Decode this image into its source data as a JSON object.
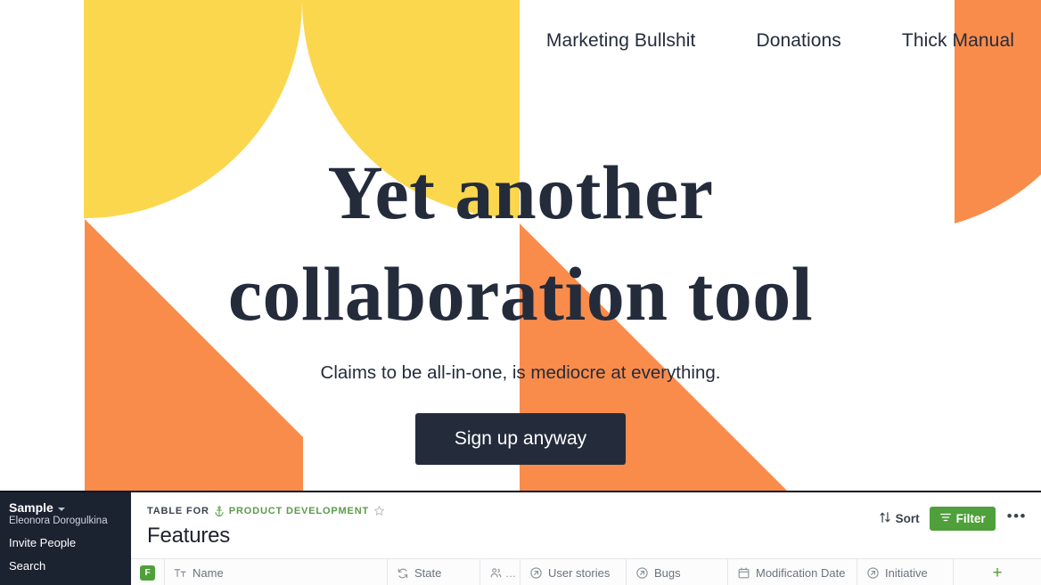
{
  "hero": {
    "nav": [
      {
        "label": "Marketing Bullshit"
      },
      {
        "label": "Donations"
      },
      {
        "label": "Thick Manual"
      }
    ],
    "title": "Yet another collaboration tool",
    "subtitle": "Claims to be all-in-one, is mediocre at everything.",
    "cta_label": "Sign up anyway",
    "colors": {
      "yellow": "#fbd74e",
      "orange": "#fa8c4b",
      "navy": "#242c3c",
      "white": "#ffffff"
    }
  },
  "app": {
    "sidebar": {
      "workspace_name": "Sample",
      "workspace_chevron": "chevron-down-icon",
      "user_name": "Eleonora Dorogulkina",
      "items": [
        {
          "label": "Invite People"
        },
        {
          "label": "Search"
        }
      ]
    },
    "main": {
      "breadcrumb_prefix": "TABLE FOR",
      "breadcrumb_icon": "anchor-icon",
      "breadcrumb_link": "PRODUCT DEVELOPMENT",
      "favorite_icon": "star-outline-icon",
      "page_title": "Features",
      "actions": {
        "sort_label": "Sort",
        "sort_icon": "sort-arrows-icon",
        "filter_label": "Filter",
        "filter_icon": "filter-lines-icon",
        "more_label": "•••",
        "filter_color": "#4fa03a"
      },
      "table": {
        "entity_badge": "F",
        "columns": [
          {
            "label": "Name",
            "icon": "text-format-icon"
          },
          {
            "label": "State",
            "icon": "state-icon"
          },
          {
            "label": "",
            "icon": "people-icon",
            "truncated": "…"
          },
          {
            "label": "User stories",
            "icon": "link-arrow-icon"
          },
          {
            "label": "Bugs",
            "icon": "link-arrow-icon"
          },
          {
            "label": "Modification Date",
            "icon": "calendar-icon"
          },
          {
            "label": "Initiative",
            "icon": "link-arrow-icon"
          }
        ],
        "add_column_label": "+"
      }
    }
  }
}
